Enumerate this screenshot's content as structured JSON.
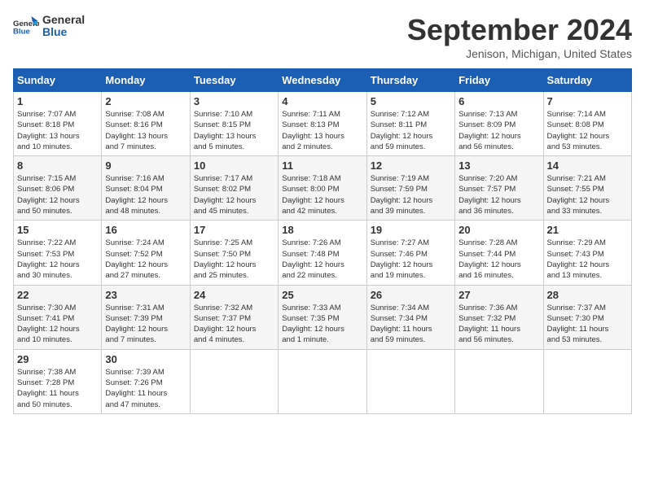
{
  "header": {
    "logo_line1": "General",
    "logo_line2": "Blue",
    "month_title": "September 2024",
    "location": "Jenison, Michigan, United States"
  },
  "weekdays": [
    "Sunday",
    "Monday",
    "Tuesday",
    "Wednesday",
    "Thursday",
    "Friday",
    "Saturday"
  ],
  "weeks": [
    [
      {
        "day": 1,
        "info": "Sunrise: 7:07 AM\nSunset: 8:18 PM\nDaylight: 13 hours\nand 10 minutes."
      },
      {
        "day": 2,
        "info": "Sunrise: 7:08 AM\nSunset: 8:16 PM\nDaylight: 13 hours\nand 7 minutes."
      },
      {
        "day": 3,
        "info": "Sunrise: 7:10 AM\nSunset: 8:15 PM\nDaylight: 13 hours\nand 5 minutes."
      },
      {
        "day": 4,
        "info": "Sunrise: 7:11 AM\nSunset: 8:13 PM\nDaylight: 13 hours\nand 2 minutes."
      },
      {
        "day": 5,
        "info": "Sunrise: 7:12 AM\nSunset: 8:11 PM\nDaylight: 12 hours\nand 59 minutes."
      },
      {
        "day": 6,
        "info": "Sunrise: 7:13 AM\nSunset: 8:09 PM\nDaylight: 12 hours\nand 56 minutes."
      },
      {
        "day": 7,
        "info": "Sunrise: 7:14 AM\nSunset: 8:08 PM\nDaylight: 12 hours\nand 53 minutes."
      }
    ],
    [
      {
        "day": 8,
        "info": "Sunrise: 7:15 AM\nSunset: 8:06 PM\nDaylight: 12 hours\nand 50 minutes."
      },
      {
        "day": 9,
        "info": "Sunrise: 7:16 AM\nSunset: 8:04 PM\nDaylight: 12 hours\nand 48 minutes."
      },
      {
        "day": 10,
        "info": "Sunrise: 7:17 AM\nSunset: 8:02 PM\nDaylight: 12 hours\nand 45 minutes."
      },
      {
        "day": 11,
        "info": "Sunrise: 7:18 AM\nSunset: 8:00 PM\nDaylight: 12 hours\nand 42 minutes."
      },
      {
        "day": 12,
        "info": "Sunrise: 7:19 AM\nSunset: 7:59 PM\nDaylight: 12 hours\nand 39 minutes."
      },
      {
        "day": 13,
        "info": "Sunrise: 7:20 AM\nSunset: 7:57 PM\nDaylight: 12 hours\nand 36 minutes."
      },
      {
        "day": 14,
        "info": "Sunrise: 7:21 AM\nSunset: 7:55 PM\nDaylight: 12 hours\nand 33 minutes."
      }
    ],
    [
      {
        "day": 15,
        "info": "Sunrise: 7:22 AM\nSunset: 7:53 PM\nDaylight: 12 hours\nand 30 minutes."
      },
      {
        "day": 16,
        "info": "Sunrise: 7:24 AM\nSunset: 7:52 PM\nDaylight: 12 hours\nand 27 minutes."
      },
      {
        "day": 17,
        "info": "Sunrise: 7:25 AM\nSunset: 7:50 PM\nDaylight: 12 hours\nand 25 minutes."
      },
      {
        "day": 18,
        "info": "Sunrise: 7:26 AM\nSunset: 7:48 PM\nDaylight: 12 hours\nand 22 minutes."
      },
      {
        "day": 19,
        "info": "Sunrise: 7:27 AM\nSunset: 7:46 PM\nDaylight: 12 hours\nand 19 minutes."
      },
      {
        "day": 20,
        "info": "Sunrise: 7:28 AM\nSunset: 7:44 PM\nDaylight: 12 hours\nand 16 minutes."
      },
      {
        "day": 21,
        "info": "Sunrise: 7:29 AM\nSunset: 7:43 PM\nDaylight: 12 hours\nand 13 minutes."
      }
    ],
    [
      {
        "day": 22,
        "info": "Sunrise: 7:30 AM\nSunset: 7:41 PM\nDaylight: 12 hours\nand 10 minutes."
      },
      {
        "day": 23,
        "info": "Sunrise: 7:31 AM\nSunset: 7:39 PM\nDaylight: 12 hours\nand 7 minutes."
      },
      {
        "day": 24,
        "info": "Sunrise: 7:32 AM\nSunset: 7:37 PM\nDaylight: 12 hours\nand 4 minutes."
      },
      {
        "day": 25,
        "info": "Sunrise: 7:33 AM\nSunset: 7:35 PM\nDaylight: 12 hours\nand 1 minute."
      },
      {
        "day": 26,
        "info": "Sunrise: 7:34 AM\nSunset: 7:34 PM\nDaylight: 11 hours\nand 59 minutes."
      },
      {
        "day": 27,
        "info": "Sunrise: 7:36 AM\nSunset: 7:32 PM\nDaylight: 11 hours\nand 56 minutes."
      },
      {
        "day": 28,
        "info": "Sunrise: 7:37 AM\nSunset: 7:30 PM\nDaylight: 11 hours\nand 53 minutes."
      }
    ],
    [
      {
        "day": 29,
        "info": "Sunrise: 7:38 AM\nSunset: 7:28 PM\nDaylight: 11 hours\nand 50 minutes."
      },
      {
        "day": 30,
        "info": "Sunrise: 7:39 AM\nSunset: 7:26 PM\nDaylight: 11 hours\nand 47 minutes."
      },
      null,
      null,
      null,
      null,
      null
    ]
  ]
}
